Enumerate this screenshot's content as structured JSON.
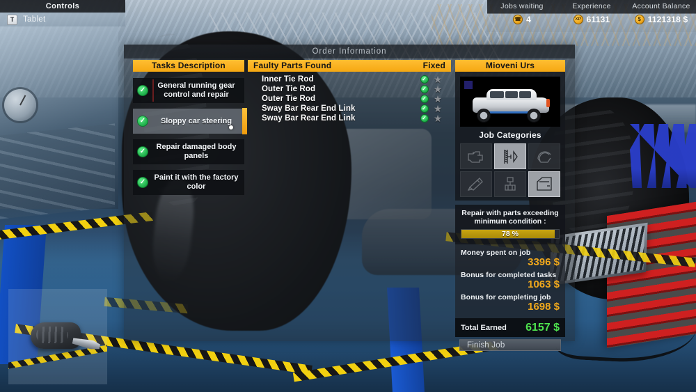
{
  "controls": {
    "title": "Controls",
    "items": [
      {
        "key": "T",
        "label": "Tablet"
      }
    ]
  },
  "stats": [
    {
      "label": "Jobs waiting",
      "icon": "phone-icon",
      "icon_glyph": "☎",
      "value": "4"
    },
    {
      "label": "Experience",
      "icon": "xp-icon",
      "icon_glyph": "XP",
      "value": "61131"
    },
    {
      "label": "Account Balance",
      "icon": "dollar-icon",
      "icon_glyph": "$",
      "value": "1121318 $"
    }
  ],
  "order_window": {
    "title": "Order Information",
    "tasks": {
      "header": "Tasks Description",
      "items": [
        {
          "label": "General running gear control and repair",
          "done": true,
          "selected": false
        },
        {
          "label": "Sloppy car steering",
          "done": true,
          "selected": true
        },
        {
          "label": "Repair damaged body panels",
          "done": true,
          "selected": false
        },
        {
          "label": "Paint it with the factory color",
          "done": true,
          "selected": false
        }
      ]
    },
    "parts": {
      "header_name": "Faulty Parts Found",
      "header_fixed": "Fixed",
      "items": [
        {
          "name": "Inner Tie Rod",
          "fixed": true,
          "star": false
        },
        {
          "name": "Outer Tie Rod",
          "fixed": true,
          "star": false
        },
        {
          "name": "Outer Tie Rod",
          "fixed": true,
          "star": false
        },
        {
          "name": "Sway Bar Rear End Link",
          "fixed": true,
          "star": false
        },
        {
          "name": "Sway Bar Rear End Link",
          "fixed": true,
          "star": false
        }
      ]
    },
    "vehicle": {
      "name": "Mioveni Urs",
      "categories_label": "Job Categories",
      "categories": [
        {
          "id": "engine-icon",
          "active": false
        },
        {
          "id": "suspension-icon",
          "active": true
        },
        {
          "id": "brakes-icon",
          "active": false
        },
        {
          "id": "exhaust-icon",
          "active": false
        },
        {
          "id": "transmission-icon",
          "active": false
        },
        {
          "id": "body-door-icon",
          "active": true
        }
      ],
      "condition_label": "Repair with parts exceeding minimum condition :",
      "condition_value": "78 %",
      "condition_percent": 96,
      "money": [
        {
          "label": "Money spent on job",
          "amount": "3396 $"
        },
        {
          "label": "Bonus for completed tasks",
          "amount": "1063 $"
        },
        {
          "label": "Bonus for completing job",
          "amount": "1698 $"
        }
      ],
      "total_label": "Total Earned",
      "total_amount": "6157 $",
      "finish_button": "Finish Job"
    }
  },
  "colors": {
    "accent_yellow": "#f5a812",
    "money_orange": "#f0a81c",
    "total_green": "#4ee24e",
    "check_green": "#22b34e",
    "star_gray": "#8b8f94"
  }
}
